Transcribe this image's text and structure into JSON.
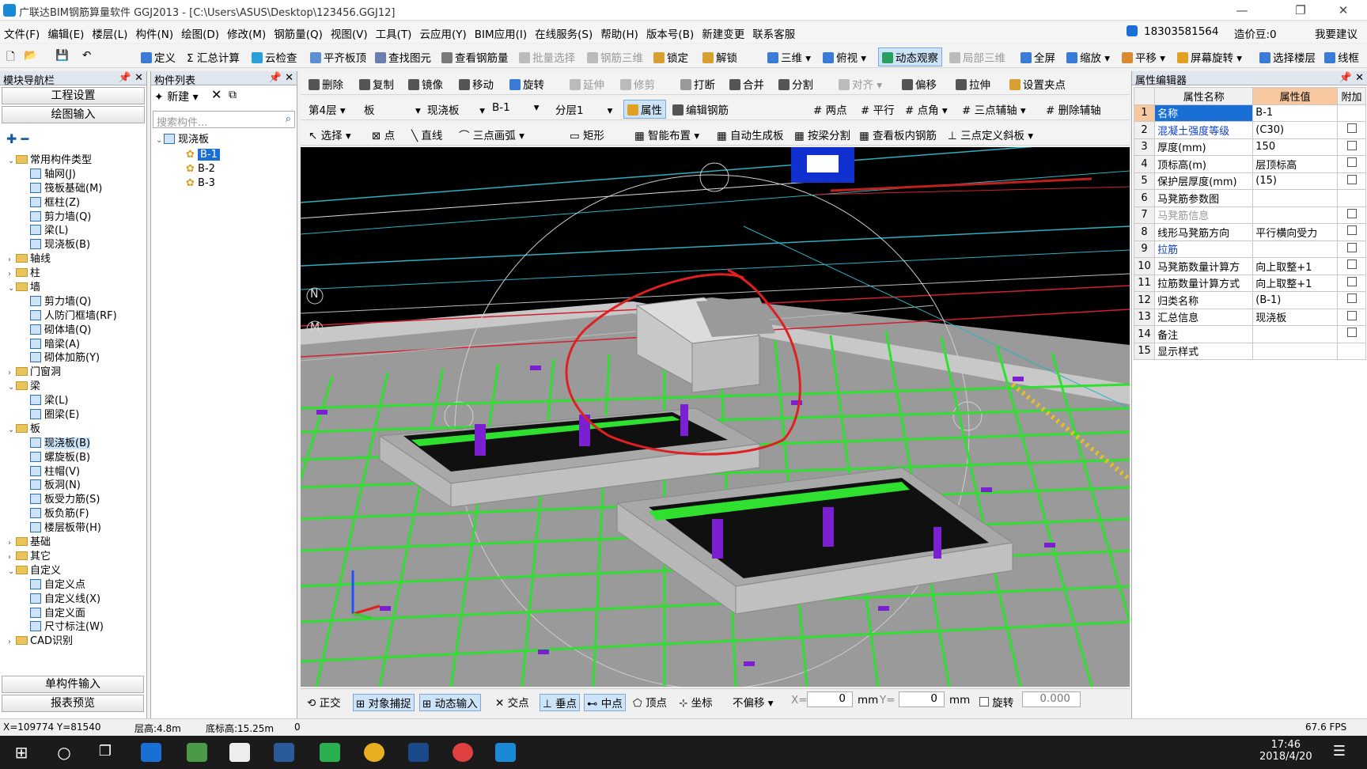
{
  "title": "广联达BIM钢筋算量软件 GGJ2013 - [C:\\Users\\ASUS\\Desktop\\123456.GGJ12]",
  "menu": [
    "文件(F)",
    "编辑(E)",
    "楼层(L)",
    "构件(N)",
    "绘图(D)",
    "修改(M)",
    "钢筋量(Q)",
    "视图(V)",
    "工具(T)",
    "云应用(Y)",
    "BIM应用(I)",
    "在线服务(S)",
    "帮助(H)",
    "版本号(B)",
    "新建变更",
    "联系客服"
  ],
  "account": {
    "phone": "18303581564",
    "cost": "造价豆:0",
    "suggest": "我要建议"
  },
  "toolbar1": [
    "定义",
    "汇总计算",
    "云检查",
    "平齐板顶",
    "查找图元",
    "查看钢筋量",
    "批量选择",
    "钢筋三维",
    "锁定",
    "解锁",
    "三维",
    "俯视",
    "动态观察",
    "局部三维",
    "全屏",
    "缩放",
    "平移",
    "屏幕旋转",
    "选择楼层",
    "线框"
  ],
  "toolbar2": [
    "删除",
    "复制",
    "镜像",
    "移动",
    "旋转",
    "延伸",
    "修剪",
    "打断",
    "合并",
    "分割",
    "对齐",
    "偏移",
    "拉伸",
    "设置夹点"
  ],
  "toolbar3": {
    "floor": "第4层",
    "type": "板",
    "subtype": "现浇板",
    "name": "B-1",
    "layer": "分层1",
    "props": "属性",
    "edit": "编辑钢筋",
    "items": [
      "两点",
      "平行",
      "点角",
      "三点辅轴",
      "删除辅轴"
    ]
  },
  "toolbar4": [
    "选择",
    "点",
    "直线",
    "三点画弧",
    "矩形",
    "智能布置",
    "自动生成板",
    "按梁分割",
    "查看板内钢筋",
    "三点定义斜板"
  ],
  "nav": {
    "header": "模块导航栏",
    "btn1": "工程设置",
    "btn2": "绘图输入",
    "btn3": "单构件输入",
    "btn4": "报表预览"
  },
  "tree": [
    {
      "t": "常用构件类型",
      "l": 0,
      "f": 1,
      "o": 1
    },
    {
      "t": "轴网(J)",
      "l": 2
    },
    {
      "t": "筏板基础(M)",
      "l": 2
    },
    {
      "t": "框柱(Z)",
      "l": 2
    },
    {
      "t": "剪力墙(Q)",
      "l": 2
    },
    {
      "t": "梁(L)",
      "l": 2
    },
    {
      "t": "现浇板(B)",
      "l": 2
    },
    {
      "t": "轴线",
      "l": 0,
      "f": 1
    },
    {
      "t": "柱",
      "l": 0,
      "f": 1
    },
    {
      "t": "墙",
      "l": 0,
      "f": 1,
      "o": 1
    },
    {
      "t": "剪力墙(Q)",
      "l": 2
    },
    {
      "t": "人防门框墙(RF)",
      "l": 2
    },
    {
      "t": "砌体墙(Q)",
      "l": 2
    },
    {
      "t": "暗梁(A)",
      "l": 2
    },
    {
      "t": "砌体加筋(Y)",
      "l": 2
    },
    {
      "t": "门窗洞",
      "l": 0,
      "f": 1
    },
    {
      "t": "梁",
      "l": 0,
      "f": 1,
      "o": 1
    },
    {
      "t": "梁(L)",
      "l": 2
    },
    {
      "t": "圈梁(E)",
      "l": 2
    },
    {
      "t": "板",
      "l": 0,
      "f": 1,
      "o": 1
    },
    {
      "t": "现浇板(B)",
      "l": 2,
      "s": 1
    },
    {
      "t": "螺旋板(B)",
      "l": 2
    },
    {
      "t": "柱帽(V)",
      "l": 2
    },
    {
      "t": "板洞(N)",
      "l": 2
    },
    {
      "t": "板受力筋(S)",
      "l": 2
    },
    {
      "t": "板负筋(F)",
      "l": 2
    },
    {
      "t": "楼层板带(H)",
      "l": 2
    },
    {
      "t": "基础",
      "l": 0,
      "f": 1
    },
    {
      "t": "其它",
      "l": 0,
      "f": 1
    },
    {
      "t": "自定义",
      "l": 0,
      "f": 1,
      "o": 1
    },
    {
      "t": "自定义点",
      "l": 2
    },
    {
      "t": "自定义线(X)",
      "l": 2
    },
    {
      "t": "自定义面",
      "l": 2
    },
    {
      "t": "尺寸标注(W)",
      "l": 2
    },
    {
      "t": "CAD识别",
      "l": 0,
      "f": 1
    }
  ],
  "complist": {
    "header": "构件列表",
    "new": "新建",
    "search": "搜索构件...",
    "root": "现浇板",
    "items": [
      "B-1",
      "B-2",
      "B-3"
    ]
  },
  "props": {
    "header": "属性编辑器",
    "cols": [
      "属性名称",
      "属性值",
      "附加"
    ],
    "rows": [
      {
        "n": "1",
        "name": "名称",
        "val": "B-1",
        "c": "blue",
        "cb": 0
      },
      {
        "n": "2",
        "name": "混凝土强度等级",
        "val": "(C30)",
        "c": "blue",
        "cb": 1
      },
      {
        "n": "3",
        "name": "厚度(mm)",
        "val": "150",
        "c": "",
        "cb": 1
      },
      {
        "n": "4",
        "name": "顶标高(m)",
        "val": "层顶标高",
        "c": "",
        "cb": 1
      },
      {
        "n": "5",
        "name": "保护层厚度(mm)",
        "val": "(15)",
        "c": "",
        "cb": 1
      },
      {
        "n": "6",
        "name": "马凳筋参数图",
        "val": "",
        "c": "",
        "cb": 0
      },
      {
        "n": "7",
        "name": "马凳筋信息",
        "val": "",
        "c": "gray",
        "cb": 1
      },
      {
        "n": "8",
        "name": "线形马凳筋方向",
        "val": "平行横向受力",
        "c": "",
        "cb": 1
      },
      {
        "n": "9",
        "name": "拉筋",
        "val": "",
        "c": "blue",
        "cb": 1
      },
      {
        "n": "10",
        "name": "马凳筋数量计算方",
        "val": "向上取整+1",
        "c": "",
        "cb": 1
      },
      {
        "n": "11",
        "name": "拉筋数量计算方式",
        "val": "向上取整+1",
        "c": "",
        "cb": 1
      },
      {
        "n": "12",
        "name": "归类名称",
        "val": "(B-1)",
        "c": "",
        "cb": 1
      },
      {
        "n": "13",
        "name": "汇总信息",
        "val": "现浇板",
        "c": "",
        "cb": 1
      },
      {
        "n": "14",
        "name": "备注",
        "val": "",
        "c": "",
        "cb": 1
      },
      {
        "n": "15",
        "name": "显示样式",
        "val": "",
        "c": "",
        "cb": 0
      }
    ]
  },
  "snap": {
    "items": [
      "正交",
      "对象捕捉",
      "动态输入",
      "交点",
      "垂点",
      "中点",
      "顶点",
      "坐标"
    ],
    "mode": "不偏移",
    "x": "0",
    "y": "0",
    "unit": "mm",
    "rot": "旋转",
    "rotval": "0.000"
  },
  "status": {
    "coords": "X=109774 Y=81540",
    "floor_h": "层高:4.8m",
    "base": "底标高:15.25m",
    "zero": "0",
    "fps": "67.6 FPS"
  },
  "axis": {
    "n": "N",
    "m": "M"
  },
  "clock": {
    "time": "17:46",
    "date": "2018/4/20"
  }
}
